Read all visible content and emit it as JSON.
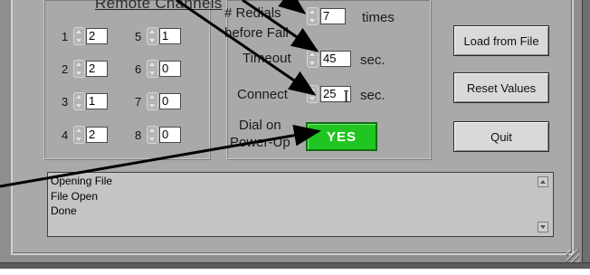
{
  "remote_channels": {
    "title": "Remote Channels",
    "channels": [
      {
        "num": "1",
        "value": "2"
      },
      {
        "num": "2",
        "value": "2"
      },
      {
        "num": "3",
        "value": "1"
      },
      {
        "num": "4",
        "value": "2"
      },
      {
        "num": "5",
        "value": "1"
      },
      {
        "num": "6",
        "value": "0"
      },
      {
        "num": "7",
        "value": "0"
      },
      {
        "num": "8",
        "value": "0"
      }
    ]
  },
  "settings": {
    "redials_label_1": "# Redials",
    "redials_label_2": "before Fail",
    "redials_value": "7",
    "redials_unit": "times",
    "timeout_label": "Timeout",
    "timeout_value": "45",
    "timeout_unit": "sec.",
    "connect_label": "Connect",
    "connect_value": "25",
    "connect_unit": "sec.",
    "dial_label_1": "Dial on",
    "dial_label_2": "Power-Up",
    "dial_value": "YES"
  },
  "buttons": {
    "load": "Load from File",
    "reset": "Reset Values",
    "quit": "Quit"
  },
  "log": {
    "lines": [
      "Opening File",
      "File Open",
      "Done"
    ]
  }
}
